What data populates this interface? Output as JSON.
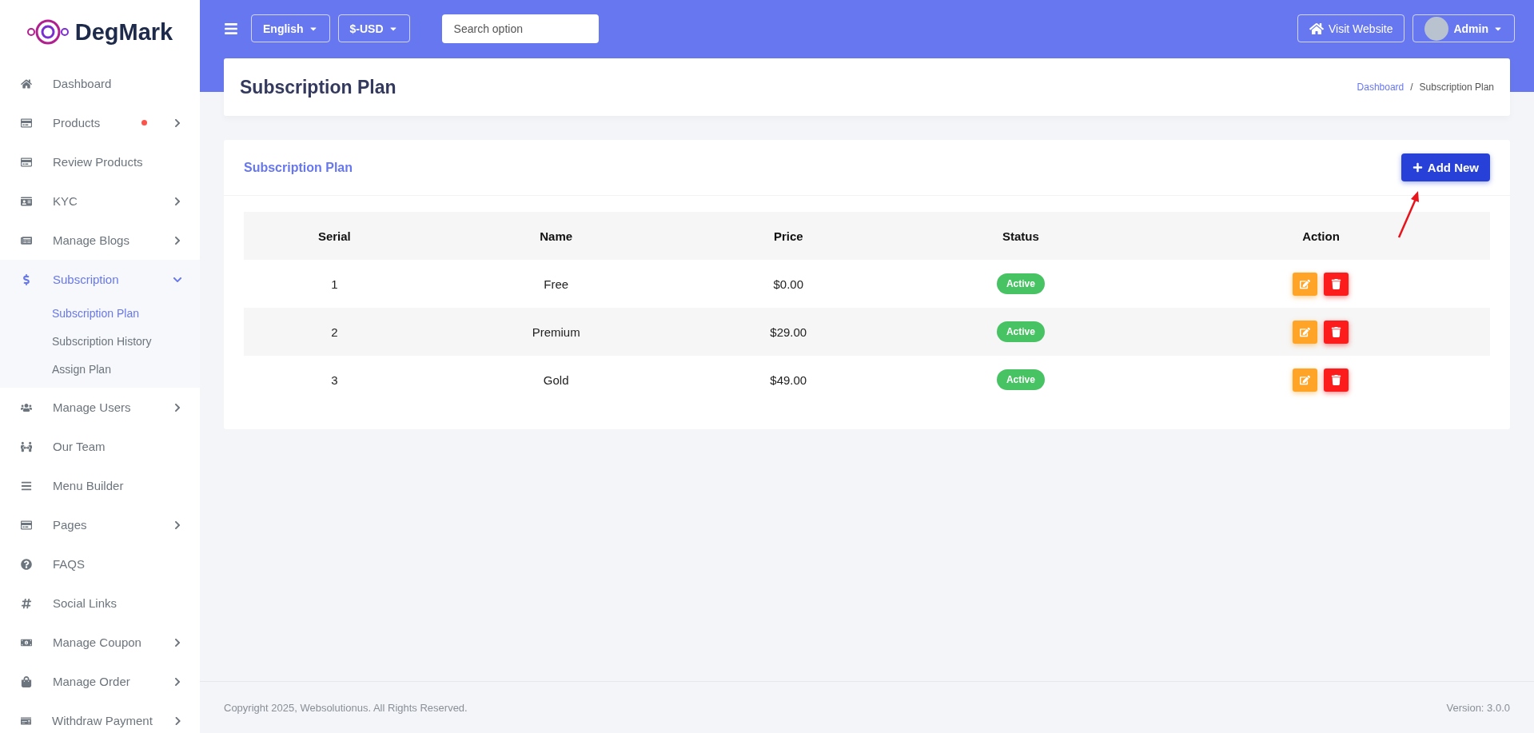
{
  "brand": {
    "name": "DegMark"
  },
  "sidebar": {
    "items": [
      {
        "label": "Dashboard",
        "has_submenu": false,
        "dot": false,
        "selected": false
      },
      {
        "label": "Products",
        "has_submenu": true,
        "dot": true,
        "selected": false,
        "expanded": false
      },
      {
        "label": "Review Products",
        "has_submenu": false,
        "dot": false,
        "selected": false
      },
      {
        "label": "KYC",
        "has_submenu": true,
        "dot": false,
        "selected": false,
        "expanded": false
      },
      {
        "label": "Manage Blogs",
        "has_submenu": true,
        "dot": false,
        "selected": false,
        "expanded": false
      },
      {
        "label": "Subscription",
        "has_submenu": true,
        "dot": false,
        "selected": true,
        "expanded": true,
        "children": [
          {
            "label": "Subscription Plan",
            "selected": true
          },
          {
            "label": "Subscription History",
            "selected": false
          },
          {
            "label": "Assign Plan",
            "selected": false
          }
        ]
      },
      {
        "label": "Manage Users",
        "has_submenu": true,
        "dot": false,
        "selected": false,
        "expanded": false
      },
      {
        "label": "Our Team",
        "has_submenu": false,
        "dot": false,
        "selected": false
      },
      {
        "label": "Menu Builder",
        "has_submenu": false,
        "dot": false,
        "selected": false
      },
      {
        "label": "Pages",
        "has_submenu": true,
        "dot": false,
        "selected": false,
        "expanded": false
      },
      {
        "label": "FAQS",
        "has_submenu": false,
        "dot": false,
        "selected": false
      },
      {
        "label": "Social Links",
        "has_submenu": false,
        "dot": false,
        "selected": false
      },
      {
        "label": "Manage Coupon",
        "has_submenu": true,
        "dot": false,
        "selected": false,
        "expanded": false
      },
      {
        "label": "Manage Order",
        "has_submenu": true,
        "dot": false,
        "selected": false,
        "expanded": false
      },
      {
        "label": "Withdraw Payment",
        "has_submenu": true,
        "dot": false,
        "selected": false,
        "expanded": false
      }
    ]
  },
  "topbar": {
    "language": "English",
    "currency": "$-USD",
    "search": {
      "placeholder": "Search option"
    },
    "visit_website": "Visit Website",
    "user": "Admin"
  },
  "page_header": {
    "title": "Subscription Plan",
    "breadcrumb": [
      "Dashboard",
      "Subscription Plan"
    ],
    "breadcrumb_separator": "/"
  },
  "card": {
    "title": "Subscription Plan",
    "add_button": "Add New"
  },
  "table": {
    "columns": [
      "Serial",
      "Name",
      "Price",
      "Status",
      "Action"
    ],
    "rows": [
      {
        "serial": "1",
        "name": "Free",
        "price": "$0.00",
        "status": "Active",
        "active": true
      },
      {
        "serial": "2",
        "name": "Premium",
        "price": "$29.00",
        "status": "Active",
        "active": true
      },
      {
        "serial": "3",
        "name": "Gold",
        "price": "$49.00",
        "status": "Active",
        "active": true
      }
    ]
  },
  "footer": {
    "copyright": "Copyright 2025, Websolutionus. All Rights Reserved.",
    "version": "Version: 3.0.0"
  }
}
